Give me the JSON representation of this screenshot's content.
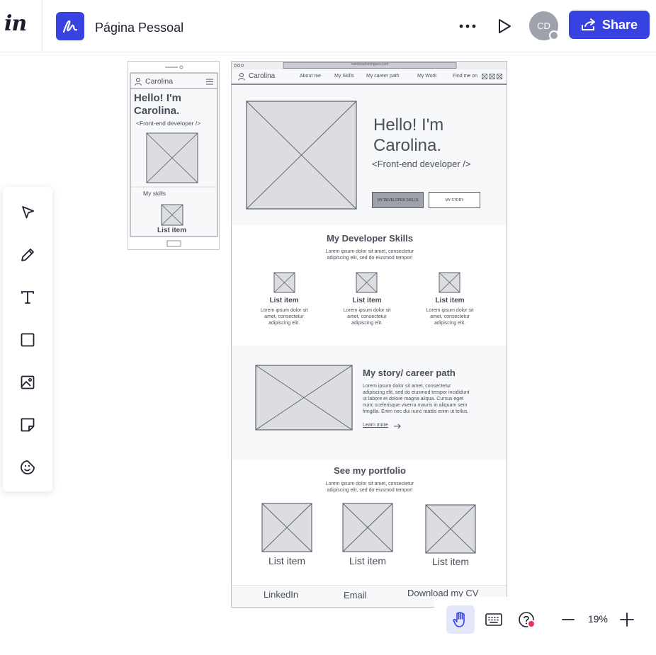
{
  "header": {
    "logo_text": "in",
    "document_title": "Página Pessoal",
    "avatar_initials": "CD",
    "share_label": "Share"
  },
  "toolbar": {
    "tools": [
      {
        "name": "select-tool",
        "icon": "cursor-arrow-icon"
      },
      {
        "name": "pen-tool",
        "icon": "pencil-icon"
      },
      {
        "name": "text-tool",
        "icon": "text-t-icon"
      },
      {
        "name": "shape-tool",
        "icon": "square-icon"
      },
      {
        "name": "image-tool",
        "icon": "image-icon"
      },
      {
        "name": "sticky-note-tool",
        "icon": "sticky-note-icon"
      },
      {
        "name": "sticker-tool",
        "icon": "smiley-sticker-icon"
      }
    ]
  },
  "mobile_frame": {
    "brand": "Carolina",
    "hero_title_line1": "Hello! I'm",
    "hero_title_line2": "Carolina.",
    "hero_subtitle": "<Front-end developer />",
    "skills_label": "My skills",
    "list_item": "List item"
  },
  "desktop_frame": {
    "url": "carolinadomingues.com",
    "brand": "Carolina",
    "nav": [
      "About me",
      "My Skills",
      "My career path",
      "My Work",
      "Find me on"
    ],
    "hero_title_line1": "Hello! I'm",
    "hero_title_line2": "Carolina.",
    "hero_subtitle": "<Front-end developer />",
    "btn_primary": "MY DEVELOPER SKILLS",
    "btn_secondary": "MY STORY",
    "skills_title": "My Developer Skills",
    "skills_desc_line1": "Lorem ipsum dolor sit amet, consectetur",
    "skills_desc_line2": "adipiscing elit, sed do eiusmod tempor!",
    "skill_items": [
      {
        "title": "List item",
        "l1": "Lorem ipsum dolor sit",
        "l2": "amet, consectetur",
        "l3": "adipiscing elit."
      },
      {
        "title": "List item",
        "l1": "Lorem ipsum dolor sit",
        "l2": "amet, consectetur",
        "l3": "adipiscing elit."
      },
      {
        "title": "List item",
        "l1": "Lorem ipsum dolor sit",
        "l2": "amet, consectetur",
        "l3": "adipiscing elit."
      }
    ],
    "story_title": "My story/ career path",
    "story_lines": [
      "Lorem ipsum dolor sit amet, consectetur",
      "adipiscing elit, sed do eiusmod tempor incididunt",
      "ut labore et dolore magna aliqua. Cursus eget",
      "nunc scelerisque viverra mauris in aliquam sem",
      "fringilla. Enim nec dui nunc mattis enim ut tellus."
    ],
    "learn_more": "Learn more",
    "portfolio_title": "See my portfolio",
    "portfolio_desc_line1": "Lorem ipsum dolor sit amet, consectetur",
    "portfolio_desc_line2": "adipiscing elit, sed do eiusmod tempor!",
    "portfolio_items": [
      "List item",
      "List item",
      "List item"
    ],
    "footer_links": [
      "LinkedIn",
      "Email",
      "Download my CV"
    ]
  },
  "bottom_controls": {
    "zoom_level": "19%"
  },
  "colors": {
    "accent": "#3742e0",
    "avatar_bg": "#9ea2ad",
    "notification_dot": "#e8355a",
    "wireframe_fill": "#dcdde1",
    "wireframe_stroke": "#5a5e6b"
  }
}
